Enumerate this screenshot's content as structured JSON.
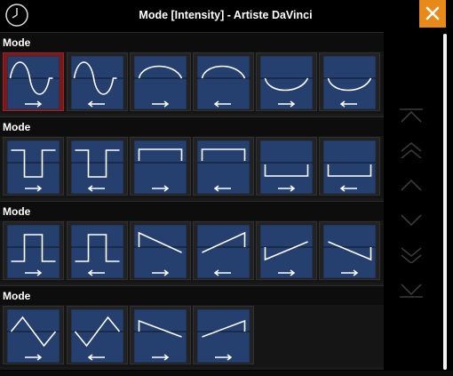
{
  "window": {
    "title": "Mode [Intensity] - Artiste DaVinci"
  },
  "colors": {
    "accent": "#e88a1a",
    "tile": "#25406e",
    "selected": "#7c1818"
  },
  "sections": [
    {
      "label": "Mode",
      "items": [
        {
          "shape": "sine",
          "direction": "right",
          "selected": true
        },
        {
          "shape": "sine",
          "direction": "left",
          "selected": false
        },
        {
          "shape": "arc-up",
          "direction": "right",
          "selected": false
        },
        {
          "shape": "arc-up",
          "direction": "left",
          "selected": false
        },
        {
          "shape": "arc-down",
          "direction": "right",
          "selected": false
        },
        {
          "shape": "arc-down",
          "direction": "left",
          "selected": false
        }
      ]
    },
    {
      "label": "Mode",
      "items": [
        {
          "shape": "square",
          "direction": "right",
          "selected": false
        },
        {
          "shape": "square",
          "direction": "left",
          "selected": false
        },
        {
          "shape": "gate-up",
          "direction": "right",
          "selected": false
        },
        {
          "shape": "gate-up",
          "direction": "left",
          "selected": false
        },
        {
          "shape": "gate-down",
          "direction": "right",
          "selected": false
        },
        {
          "shape": "gate-down",
          "direction": "left",
          "selected": false
        }
      ]
    },
    {
      "label": "Mode",
      "items": [
        {
          "shape": "square-inv",
          "direction": "right",
          "selected": false
        },
        {
          "shape": "square-inv",
          "direction": "left",
          "selected": false
        },
        {
          "shape": "ramp-down",
          "direction": "right",
          "selected": false
        },
        {
          "shape": "ramp-up",
          "direction": "left",
          "selected": false
        },
        {
          "shape": "ramp-up-low",
          "direction": "right",
          "selected": false
        },
        {
          "shape": "ramp-down-low",
          "direction": "right",
          "selected": false
        }
      ]
    },
    {
      "label": "Mode",
      "items": [
        {
          "shape": "triangle",
          "direction": "right",
          "selected": false
        },
        {
          "shape": "triangle-inv",
          "direction": "left",
          "selected": false
        },
        {
          "shape": "saw-down",
          "direction": "right",
          "selected": false
        },
        {
          "shape": "saw-up",
          "direction": "right",
          "selected": false
        }
      ]
    }
  ],
  "nav_buttons": [
    {
      "icon": "first-page-icon"
    },
    {
      "icon": "page-up-icon"
    },
    {
      "icon": "line-up-icon"
    },
    {
      "icon": "line-down-icon"
    },
    {
      "icon": "page-down-icon"
    },
    {
      "icon": "last-page-icon"
    }
  ]
}
